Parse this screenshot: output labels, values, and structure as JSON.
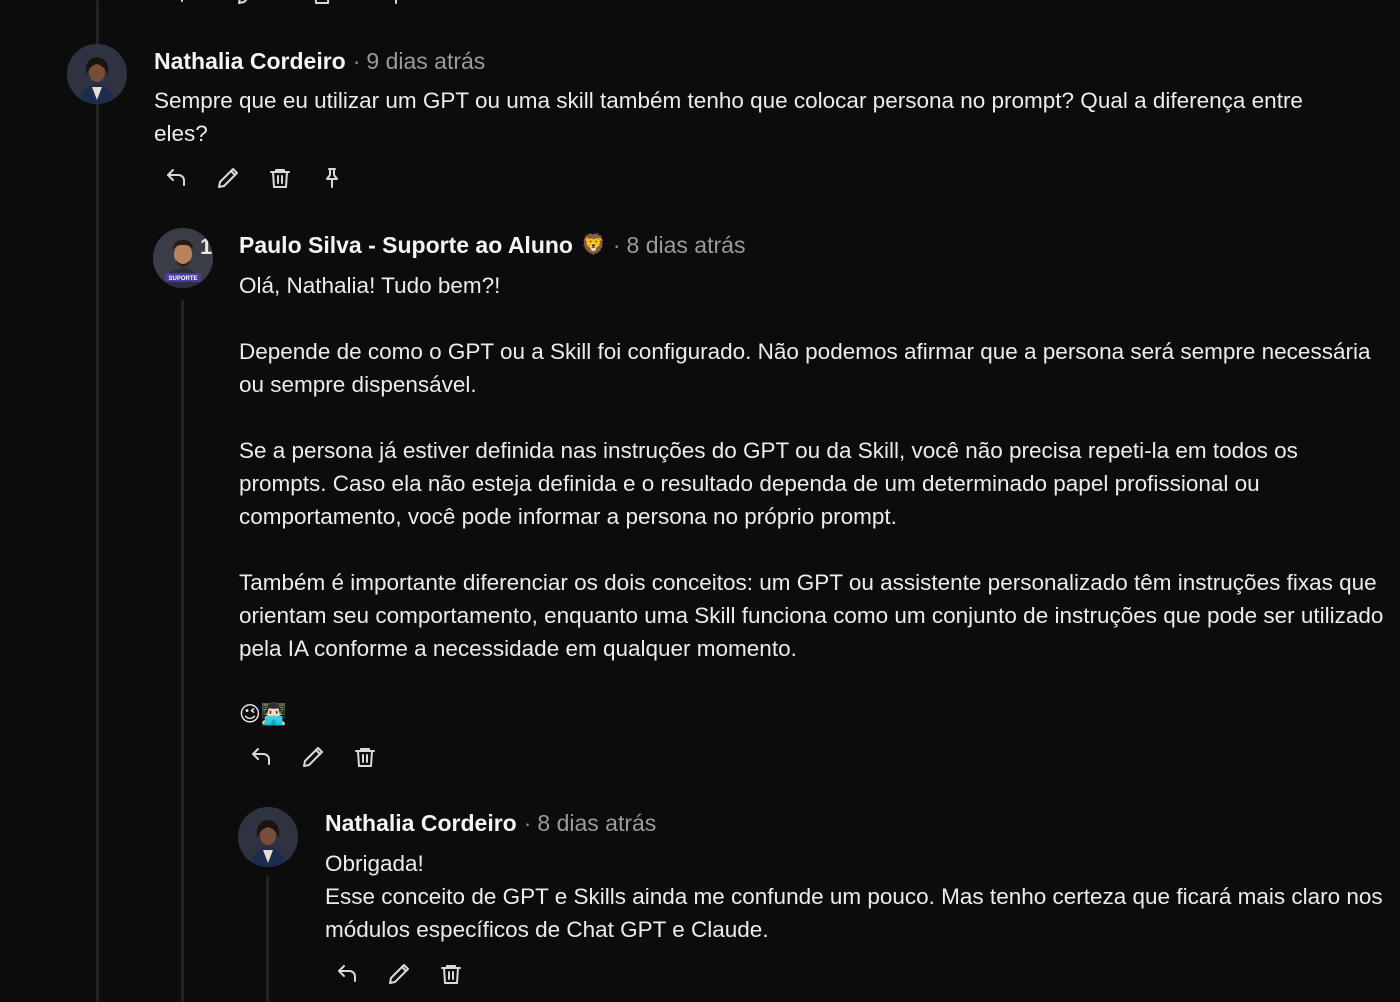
{
  "comments": [
    {
      "author": "Nathalia Cordeiro",
      "separator": "·",
      "time": "9 dias atrás",
      "paragraphs": [
        "Sempre que eu utilizar um GPT ou uma skill também tenho que colocar persona no prompt? Qual a diferença entre eles?"
      ]
    },
    {
      "author": "Paulo Silva - Suporte ao Aluno",
      "badge": "🦁",
      "avatar_caption": "SUPORTE",
      "separator": "·",
      "time": "8 dias atrás",
      "paragraphs": [
        "Olá, Nathalia! Tudo bem?!",
        "Depende de como o GPT ou a Skill foi configurado. Não podemos afirmar que a persona será sempre necessária ou sempre dispensável.",
        "Se a persona já estiver definida nas instruções do GPT ou da Skill, você não precisa repeti-la em todos os prompts. Caso ela não esteja definida e o resultado dependa de um determinado papel profissional ou comportamento, você pode informar a persona no próprio prompt.",
        "Também é importante diferenciar os dois conceitos: um GPT ou assistente personalizado têm instruções fixas que orientam seu comportamento, enquanto uma Skill funciona como um conjunto de instruções que pode ser utilizado pela IA conforme a necessidade em qualquer momento."
      ],
      "emojis": "😉👨🏻‍💻"
    },
    {
      "author": "Nathalia Cordeiro",
      "separator": "·",
      "time": "8 dias atrás",
      "lines": [
        "Obrigada!",
        "Esse conceito de GPT e Skills ainda me confunde um pouco. Mas tenho certeza que ficará mais claro nos módulos específicos de Chat GPT e Claude."
      ]
    }
  ],
  "actions": {
    "reply": "reply-icon",
    "edit": "pencil-icon",
    "delete": "trash-icon",
    "pin": "pin-icon"
  },
  "colors": {
    "background": "#0c0c0d",
    "text": "#ececec",
    "muted": "#9a9a9f",
    "thread_line": "#232325"
  }
}
